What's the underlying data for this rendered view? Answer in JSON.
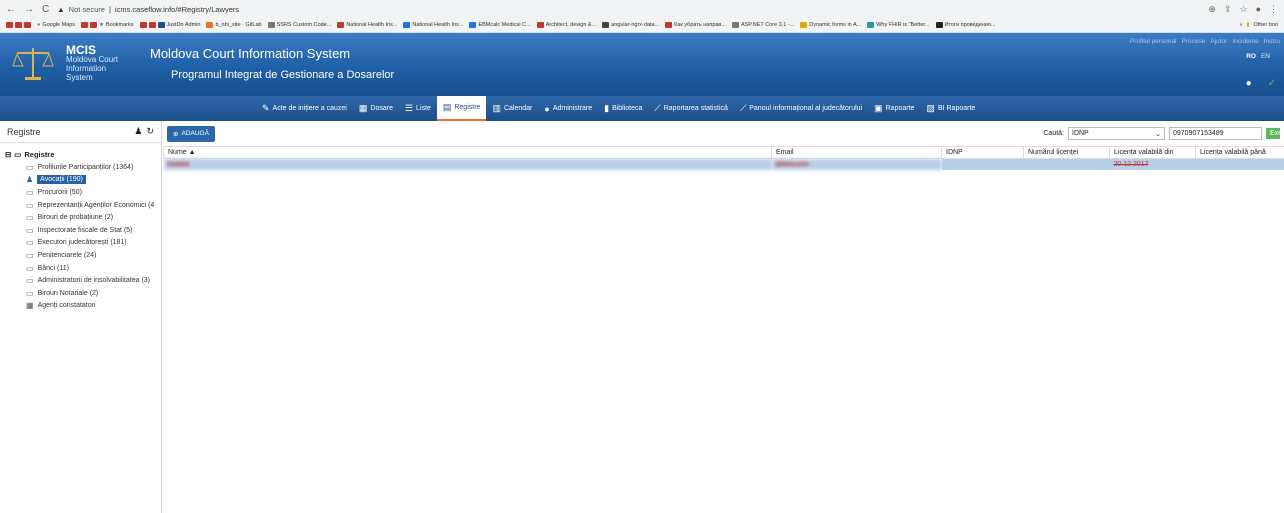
{
  "browser": {
    "security": "Not secure",
    "url": "icms.caseflow.info/#Registry/Lawyers",
    "bookmarks": [
      "Google Maps",
      "Bookmarks",
      "JustDo Admin",
      "b_nhi_site · GitLab",
      "SSRS Custom Code...",
      "National Health Ins...",
      "National Health Ins...",
      "EBMcalc Medical C...",
      "Architect, design &...",
      "angular-ngrx-data...",
      "Как убрать направ...",
      "ASP.NET Core 3.1 -...",
      "Dynamic forms in A...",
      "Why FHIR is \"Better...",
      "Итоги проведения..."
    ],
    "other_bookmarks": "Other boo"
  },
  "header": {
    "logo_big": "MCIS",
    "logo_line1": "Moldova Court",
    "logo_line2": "Information",
    "logo_line3": "System",
    "system_title": "Moldova Court Information System",
    "system_subtitle": "Programul Integrat de Gestionare a Dosarelor",
    "top_links": [
      "Profilul personal",
      "Procese",
      "Ajutor",
      "Incidente",
      "Instru"
    ],
    "lang_ro": "RO",
    "lang_en": "EN"
  },
  "nav": [
    {
      "label": "Acte de inițiere a cauzei",
      "icon": "✎"
    },
    {
      "label": "Dosare",
      "icon": "▦"
    },
    {
      "label": "Liste",
      "icon": "☰"
    },
    {
      "label": "Registre",
      "icon": "▤"
    },
    {
      "label": "Calendar",
      "icon": "▥"
    },
    {
      "label": "Administrare",
      "icon": "●"
    },
    {
      "label": "Biblioteca",
      "icon": "▮"
    },
    {
      "label": "Raportarea statistică",
      "icon": "⟋"
    },
    {
      "label": "Panoul informațional al judecătorului",
      "icon": "⟋"
    },
    {
      "label": "Rapoarte",
      "icon": "▣"
    },
    {
      "label": "BI Rapoarte",
      "icon": "▨"
    }
  ],
  "sidebar": {
    "title": "Registre",
    "root": "Registre",
    "items": [
      "Profilurile Participanților (1364)",
      "Avocații (190)",
      "Procurorii (50)",
      "Reprezentanții Agenților Economici (4",
      "Birouri de probațiune (2)",
      "Inspectorate fiscale de Stat (5)",
      "Executori judecătorești (181)",
      "Penitenciarele (24)",
      "Bănci (11)",
      "Administratorii de insolvabilitatea (3)",
      "Birouri Notariale (2)",
      "Agenți constatatori"
    ]
  },
  "toolbar": {
    "add_label": "ADAUGĂ",
    "search_label": "Caută:",
    "search_field": "IDNP",
    "search_value": "0970907153489",
    "search_button": "Exe"
  },
  "table": {
    "columns": [
      "Nume ▲",
      "Email",
      "IDNP",
      "Numărul licenței",
      "Licența valabilă din",
      "Licența valabilă până"
    ],
    "rows": [
      [
        "Natalia",
        "@test.com",
        "",
        "",
        "20.12.2017",
        ""
      ]
    ]
  }
}
